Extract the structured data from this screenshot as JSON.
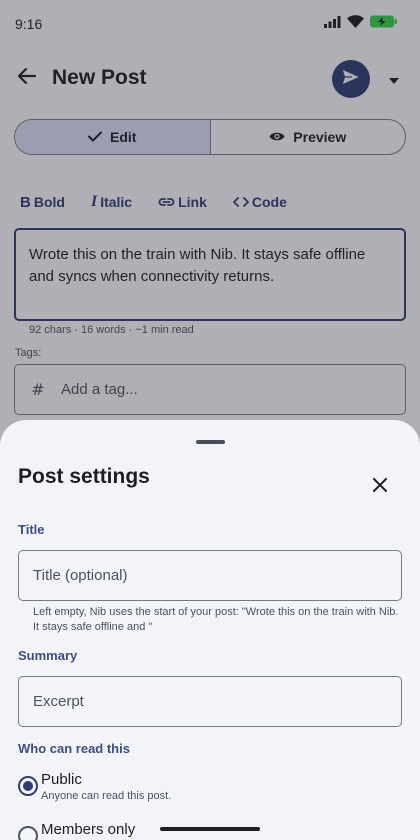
{
  "status_bar": {
    "time": "9:16"
  },
  "app_bar": {
    "title": "New Post"
  },
  "mode_tabs": [
    {
      "label": "Edit",
      "active": true
    },
    {
      "label": "Preview",
      "active": false
    }
  ],
  "format_toolbar": {
    "bold": "Bold",
    "italic": "Italic",
    "link": "Link",
    "code": "Code"
  },
  "editor": {
    "text": "Wrote this on the train with Nib. It stays safe offline and syncs when connectivity returns.",
    "stats": "92 chars · 16 words · ~1 min read"
  },
  "tags": {
    "label": "Tags:",
    "placeholder": "Add a tag..."
  },
  "sheet": {
    "title": "Post settings",
    "title_section": {
      "label": "Title",
      "placeholder": "Title (optional)",
      "helper": "Left empty, Nib uses the start of your post: \"Wrote this on the train with Nib. It stays safe offline and \""
    },
    "summary_section": {
      "label": "Summary",
      "placeholder": "Excerpt"
    },
    "visibility": {
      "label": "Who can read this",
      "options": [
        {
          "title": "Public",
          "subtitle": "Anyone can read this post.",
          "selected": true
        },
        {
          "title": "Members only",
          "subtitle": "",
          "selected": false
        }
      ]
    }
  },
  "colors": {
    "accent": "#2c3e73",
    "section_label": "#3c4d86",
    "active_segment": "#d6ddf5",
    "battery": "#35d04b"
  }
}
